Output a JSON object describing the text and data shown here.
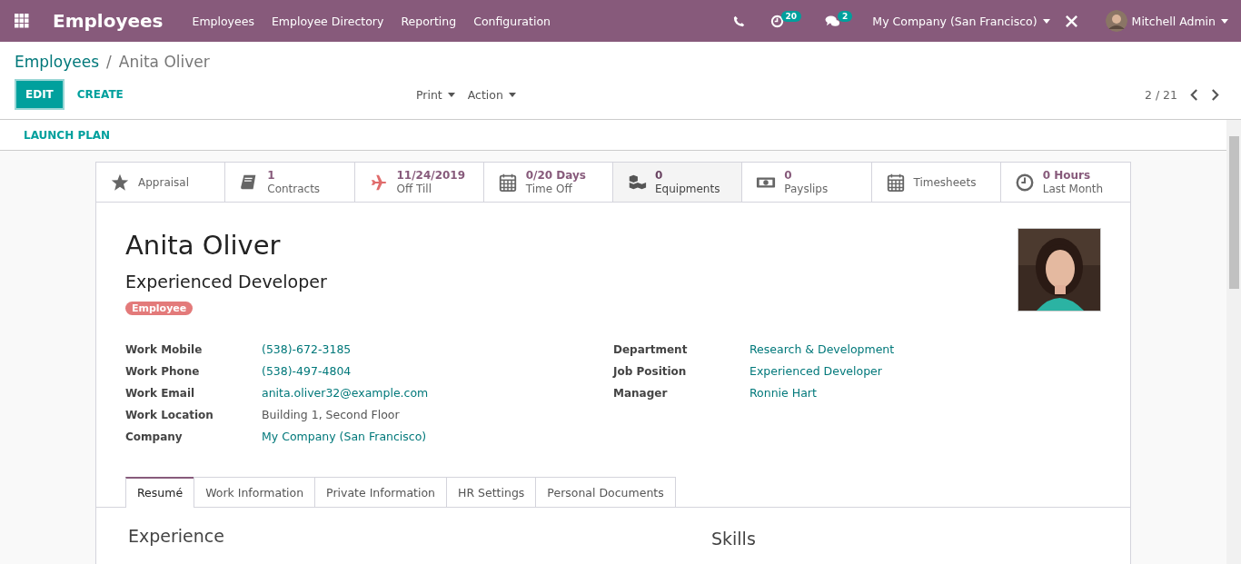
{
  "navbar": {
    "app_title": "Employees",
    "menu": [
      "Employees",
      "Employee Directory",
      "Reporting",
      "Configuration"
    ],
    "activity_count": "20",
    "message_count": "2",
    "company": "My Company (San Francisco)",
    "user": "Mitchell Admin"
  },
  "breadcrumb": {
    "parent": "Employees",
    "separator": "/",
    "current": "Anita Oliver"
  },
  "control_panel": {
    "edit": "EDIT",
    "create": "CREATE",
    "print": "Print",
    "action": "Action",
    "pager": "2 / 21"
  },
  "status_bar": {
    "button": "LAUNCH PLAN"
  },
  "smart_buttons": [
    {
      "kind": "label",
      "label": "Appraisal",
      "selected": false
    },
    {
      "kind": "stat",
      "value": "1",
      "label": "Contracts",
      "selected": false
    },
    {
      "kind": "stat",
      "value": "11/24/2019",
      "label": "Off Till",
      "selected": false
    },
    {
      "kind": "stat",
      "value": "0/20 Days",
      "label": "Time Off",
      "selected": false
    },
    {
      "kind": "stat",
      "value": "0",
      "label": "Equipments",
      "selected": true
    },
    {
      "kind": "stat",
      "value": "0",
      "label": "Payslips",
      "selected": false
    },
    {
      "kind": "label",
      "label": "Timesheets",
      "selected": false
    },
    {
      "kind": "stat",
      "value": "0 Hours",
      "label": "Last Month",
      "selected": false
    }
  ],
  "employee": {
    "name": "Anita Oliver",
    "job_title": "Experienced Developer",
    "tag": "Employee"
  },
  "fields_left": [
    {
      "label": "Work Mobile",
      "value": "(538)-672-3185",
      "kind": "link"
    },
    {
      "label": "Work Phone",
      "value": "(538)-497-4804",
      "kind": "link"
    },
    {
      "label": "Work Email",
      "value": "anita.oliver32@example.com",
      "kind": "link"
    },
    {
      "label": "Work Location",
      "value": "Building 1, Second Floor",
      "kind": "text"
    },
    {
      "label": "Company",
      "value": "My Company (San Francisco)",
      "kind": "link"
    }
  ],
  "fields_right": [
    {
      "label": "Department",
      "value": "Research & Development",
      "kind": "link"
    },
    {
      "label": "Job Position",
      "value": "Experienced Developer",
      "kind": "link"
    },
    {
      "label": "Manager",
      "value": "Ronnie Hart",
      "kind": "link"
    }
  ],
  "notebook_tabs": [
    {
      "label": "Resumé",
      "selected": true
    },
    {
      "label": "Work Information",
      "selected": false
    },
    {
      "label": "Private Information",
      "selected": false
    },
    {
      "label": "HR Settings",
      "selected": false
    },
    {
      "label": "Personal Documents",
      "selected": false
    }
  ],
  "resume": {
    "experience_heading": "Experience",
    "skills_heading": "Skills"
  }
}
